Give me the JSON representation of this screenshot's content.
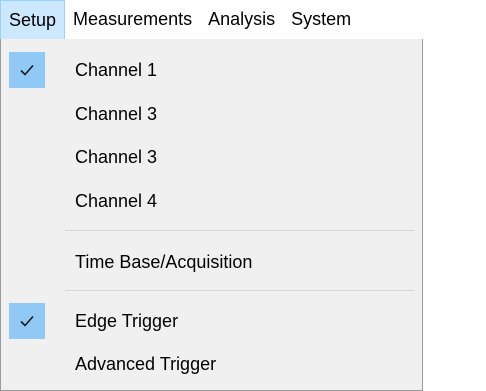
{
  "menubar": {
    "items": [
      "Setup",
      "Measurements",
      "Analysis",
      "System"
    ]
  },
  "dropdown": {
    "items": [
      {
        "label": "Channel 1",
        "checked": true
      },
      {
        "label": "Channel 3",
        "checked": false
      },
      {
        "label": "Channel 3",
        "checked": false
      },
      {
        "label": "Channel 4",
        "checked": false
      },
      {
        "label": "Time Base/Acquisition",
        "checked": false
      },
      {
        "label": "Edge Trigger",
        "checked": true
      },
      {
        "label": "Advanced Trigger",
        "checked": false
      }
    ]
  },
  "colors": {
    "menubar_highlight": "#cce8ff",
    "check_background": "#90c8f6",
    "menu_background": "#f0f0f0"
  }
}
